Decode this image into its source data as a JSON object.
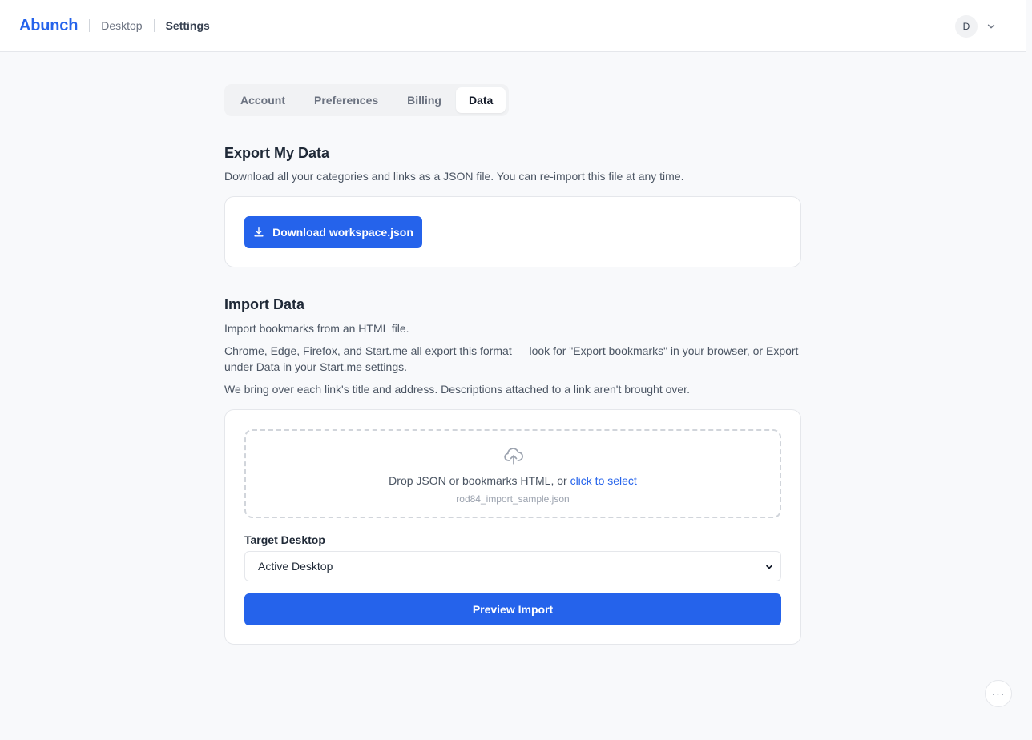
{
  "header": {
    "logo": "Abunch",
    "breadcrumbs": [
      "Desktop",
      "Settings"
    ],
    "user_initial": "D"
  },
  "tabs": [
    {
      "label": "Account",
      "active": false
    },
    {
      "label": "Preferences",
      "active": false
    },
    {
      "label": "Billing",
      "active": false
    },
    {
      "label": "Data",
      "active": true
    }
  ],
  "export": {
    "title": "Export My Data",
    "description": "Download all your categories and links as a JSON file. You can re-import this file at any time.",
    "button_label": "Download workspace.json"
  },
  "import": {
    "title": "Import Data",
    "paragraphs": [
      "Import bookmarks from an HTML file.",
      "Chrome, Edge, Firefox, and Start.me all export this format — look for \"Export bookmarks\" in your browser, or Export under Data in your Start.me settings.",
      "We bring over each link's title and address. Descriptions attached to a link aren't brought over."
    ],
    "dropzone_text": "Drop JSON or bookmarks HTML, or ",
    "dropzone_link": "click to select",
    "selected_file": "rod84_import_sample.json",
    "target_label": "Target Desktop",
    "target_value": "Active Desktop",
    "preview_button": "Preview Import"
  },
  "fab_label": "···",
  "colors": {
    "accent": "#2563eb",
    "background": "#f8f9fb"
  }
}
